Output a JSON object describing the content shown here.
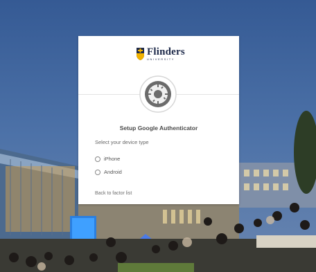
{
  "brand": {
    "name": "Flinders",
    "subtitle": "UNIVERSITY"
  },
  "factor": {
    "icon": "google-authenticator-icon"
  },
  "setup": {
    "title": "Setup Google Authenticator",
    "prompt": "Select your device type",
    "options": [
      {
        "label": "iPhone",
        "selected": false
      },
      {
        "label": "Android",
        "selected": false
      }
    ],
    "back_link": "Back to factor list"
  },
  "colors": {
    "card": "#ffffff",
    "brand_navy": "#1e2a4a",
    "brand_gold": "#f2b300"
  }
}
